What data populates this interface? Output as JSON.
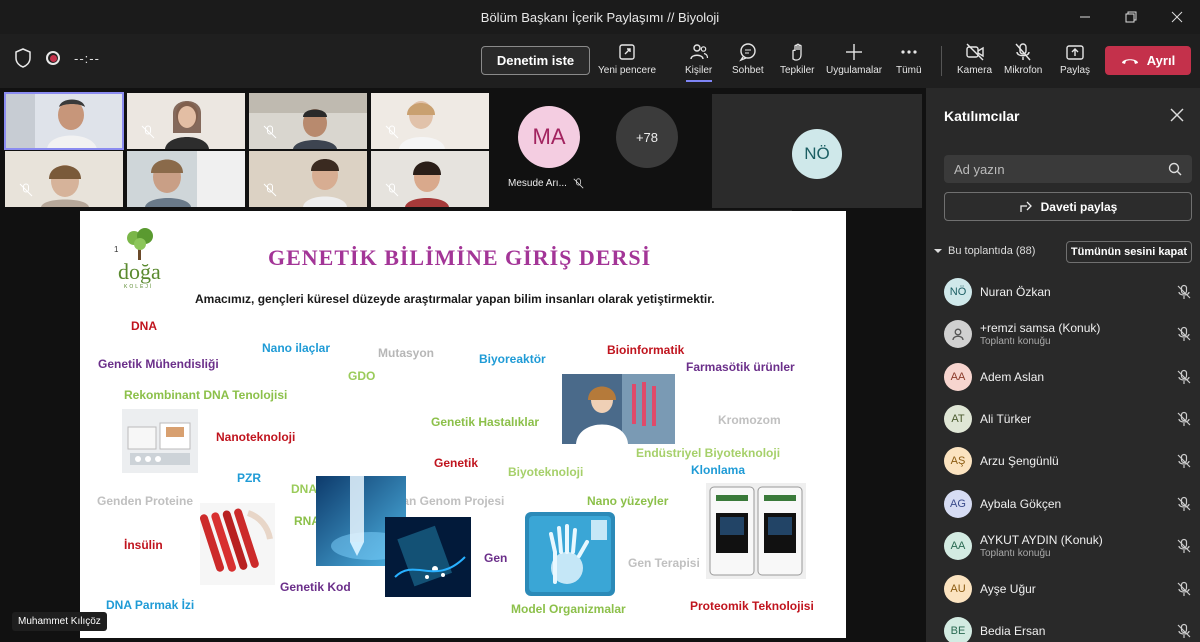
{
  "window": {
    "title": "Bölüm Başkanı İçerik Paylaşımı // Biyoloji"
  },
  "toolbar": {
    "timer": "--:--",
    "request_control": "Denetim iste",
    "tools": [
      {
        "label": "Yeni pencere",
        "icon": "popout-icon"
      },
      {
        "label": "Kişiler",
        "icon": "people-icon"
      },
      {
        "label": "Sohbet",
        "icon": "chat-icon"
      },
      {
        "label": "Tepkiler",
        "icon": "reactions-icon"
      },
      {
        "label": "Uygulamalar",
        "icon": "plus-icon"
      },
      {
        "label": "Tümü",
        "icon": "more-icon"
      },
      {
        "label": "Kamera",
        "icon": "camera-off-icon"
      },
      {
        "label": "Mikrofon",
        "icon": "mic-off-icon"
      },
      {
        "label": "Paylaş",
        "icon": "share-icon"
      }
    ],
    "leave": "Ayrıl"
  },
  "stage": {
    "ma_initials": "MA",
    "ma_name": "Mesude Arı...",
    "more_count": "+78",
    "no_initials": "NÖ",
    "presenter_name": "Muhammet Kılıçöz"
  },
  "slide": {
    "title": "GENETİK BİLİMİNE GİRİŞ DERSİ",
    "subtitle": "Amacımız, gençleri küresel düzeyde araştırmalar yapan bilim insanları olarak yetiştirmektir.",
    "logo_text": "doğa",
    "logo_sub": "KOLEJİ",
    "terms": [
      "DNA",
      "Nano ilaçlar",
      "Mutasyon",
      "Biyoreaktör",
      "Bioinformatik",
      "Genetik Mühendisliği",
      "Farmasötik ürünler",
      "GDO",
      "Rekombinant DNA Tenolojisi",
      "Nanoteknoloji",
      "Genetik Hastalıklar",
      "Kromozom",
      "Genetik",
      "Endüstriyel Biyoteknoloji",
      "Biyoteknoloji",
      "Klonlama",
      "PZR",
      "DNA Onarımı",
      "Genden Proteine",
      "İnsan Genom Projesi",
      "Nano yüzeyler",
      "RNA",
      "İnsülin",
      "Gen",
      "Gen Terapisi",
      "Genetik Kod",
      "DNA Parmak İzi",
      "Model Organizmalar",
      "Proteomik Teknolojisi"
    ]
  },
  "sidebar": {
    "title": "Katılımcılar",
    "search_placeholder": "Ad yazın",
    "share_invite": "Daveti paylaş",
    "section_label": "Bu toplantıda (88)",
    "mute_all": "Tümünün sesini kapat",
    "participants": [
      {
        "initials": "NÖ",
        "name": "Nuran Özkan",
        "sub": "",
        "bg": "#cfe8ea",
        "fg": "#1b5e63"
      },
      {
        "initials": "",
        "name": "+remzi samsa (Konuk)",
        "sub": "Toplantı konuğu",
        "bg": "#d0d0d0",
        "fg": "#555555"
      },
      {
        "initials": "AA",
        "name": "Adem Aslan",
        "sub": "",
        "bg": "#f7d5cf",
        "fg": "#8a3a2a"
      },
      {
        "initials": "AT",
        "name": "Ali Türker",
        "sub": "",
        "bg": "#dfe6d5",
        "fg": "#4a5a2e"
      },
      {
        "initials": "AŞ",
        "name": "Arzu Şengünlü",
        "sub": "",
        "bg": "#fbe3c0",
        "fg": "#8a5a10"
      },
      {
        "initials": "AG",
        "name": "Aybala Gökçen",
        "sub": "",
        "bg": "#d6dcf3",
        "fg": "#3a4a8a"
      },
      {
        "initials": "AA",
        "name": "AYKUT AYDIN (Konuk)",
        "sub": "Toplantı konuğu",
        "bg": "#d3ebe2",
        "fg": "#2a6a52"
      },
      {
        "initials": "AU",
        "name": "Ayşe Uğur",
        "sub": "",
        "bg": "#fbe3c0",
        "fg": "#8a5a10"
      },
      {
        "initials": "BE",
        "name": "Bedia Ersan",
        "sub": "",
        "bg": "#d3ebe2",
        "fg": "#2a6a52"
      }
    ]
  }
}
